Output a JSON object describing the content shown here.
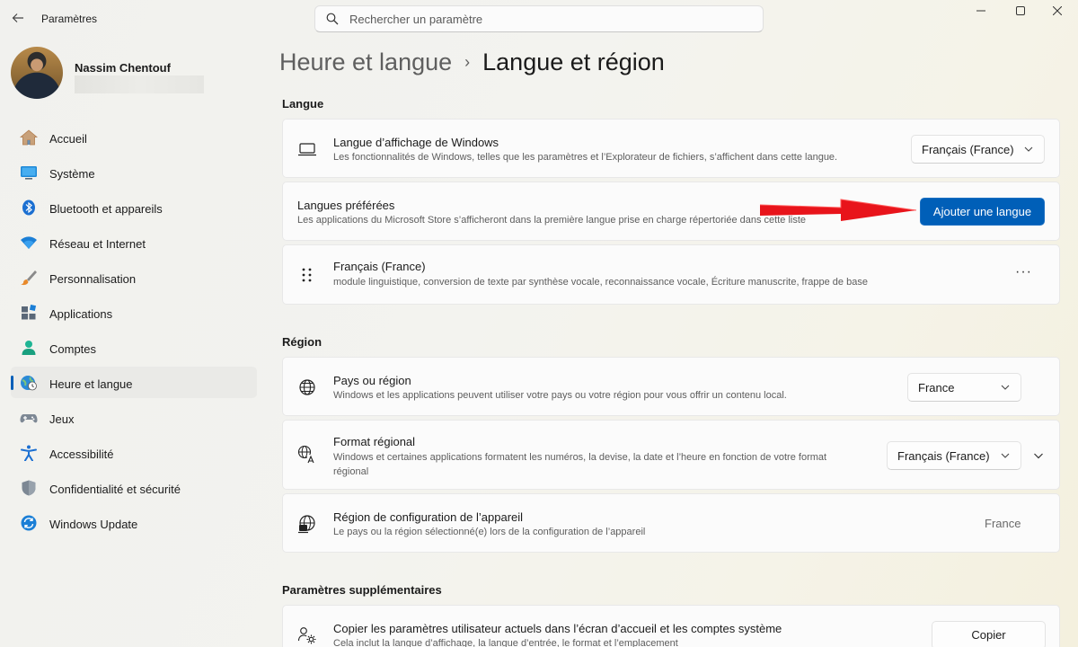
{
  "titlebar": {
    "app_title": "Paramètres",
    "search_placeholder": "Rechercher un paramètre"
  },
  "profile": {
    "name": "Nassim Chentouf"
  },
  "sidebar": {
    "items": [
      {
        "label": "Accueil",
        "icon": "home-icon"
      },
      {
        "label": "Système",
        "icon": "system-icon"
      },
      {
        "label": "Bluetooth et appareils",
        "icon": "bluetooth-icon"
      },
      {
        "label": "Réseau et Internet",
        "icon": "wifi-icon"
      },
      {
        "label": "Personnalisation",
        "icon": "brush-icon"
      },
      {
        "label": "Applications",
        "icon": "apps-icon"
      },
      {
        "label": "Comptes",
        "icon": "account-icon"
      },
      {
        "label": "Heure et langue",
        "icon": "time-language-icon",
        "active": true
      },
      {
        "label": "Jeux",
        "icon": "gamepad-icon"
      },
      {
        "label": "Accessibilité",
        "icon": "accessibility-icon"
      },
      {
        "label": "Confidentialité et sécurité",
        "icon": "shield-icon"
      },
      {
        "label": "Windows Update",
        "icon": "update-icon"
      }
    ]
  },
  "breadcrumb": {
    "parent": "Heure et langue",
    "separator": "›",
    "current": "Langue et région"
  },
  "sections": {
    "langue": {
      "title": "Langue",
      "display_language": {
        "title": "Langue d’affichage de Windows",
        "desc": "Les fonctionnalités de Windows, telles que les paramètres et l’Explorateur de fichiers, s’affichent dans cette langue.",
        "value": "Français (France)"
      },
      "preferred": {
        "title": "Langues préférées",
        "desc": "Les applications du Microsoft Store s’afficheront dans la première langue prise en charge répertoriée dans cette liste",
        "button": "Ajouter une langue"
      },
      "language_item": {
        "title": "Français (France)",
        "desc": "module linguistique, conversion de texte par synthèse vocale, reconnaissance vocale, Écriture manuscrite, frappe de base",
        "more": "···"
      }
    },
    "region": {
      "title": "Région",
      "country": {
        "title": "Pays ou région",
        "desc": "Windows et les applications peuvent utiliser votre pays ou votre région pour vous offrir un contenu local.",
        "value": "France"
      },
      "format": {
        "title": "Format régional",
        "desc_line1": "Windows et certaines applications formatent les numéros, la devise, la date et l’heure en fonction de votre format",
        "desc_line2": "régional",
        "value": "Français (France)"
      },
      "device_region": {
        "title": "Région de configuration de l’appareil",
        "desc": "Le pays ou la région sélectionné(e) lors de la configuration de l’appareil",
        "value": "France"
      }
    },
    "additional": {
      "title": "Paramètres supplémentaires",
      "copy": {
        "title": "Copier les paramètres utilisateur actuels dans l’écran d’accueil et les comptes système",
        "desc": "Cela inclut la langue d’affichage, la langue d’entrée, le format et l’emplacement",
        "button": "Copier"
      }
    }
  },
  "colors": {
    "accent": "#005fb8",
    "arrow": "#e8141b"
  }
}
